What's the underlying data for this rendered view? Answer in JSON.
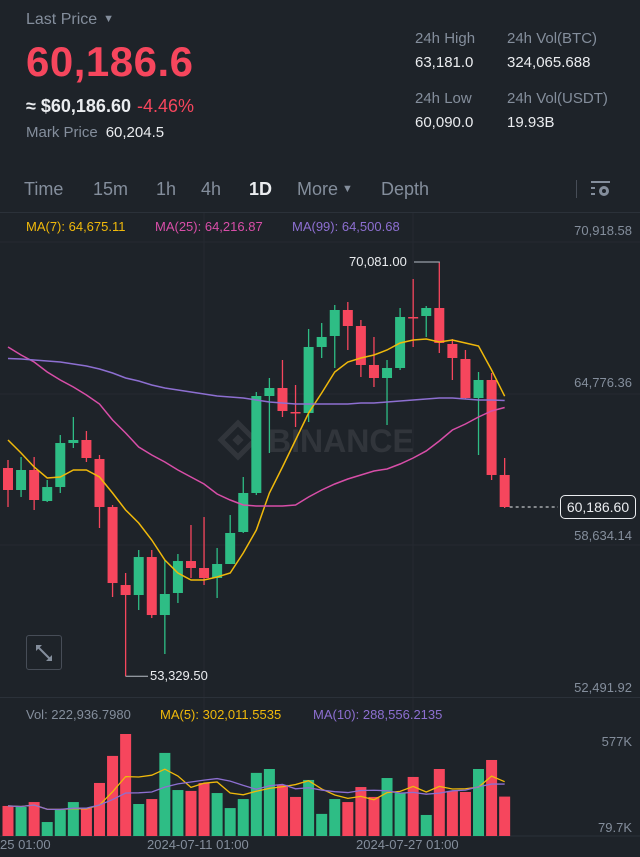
{
  "header": {
    "last_price_label": "Last Price",
    "last_price": "60,186.6",
    "usd_price": "≈ $60,186.60",
    "change_pct": "-4.46%",
    "mark_price_label": "Mark Price",
    "mark_price": "60,204.5",
    "stats": {
      "high_label": "24h High",
      "high": "63,181.0",
      "vol_btc_label": "24h Vol(BTC)",
      "vol_btc": "324,065.688",
      "low_label": "24h Low",
      "low": "60,090.0",
      "vol_usdt_label": "24h Vol(USDT)",
      "vol_usdt": "19.93B"
    }
  },
  "tabs": {
    "time": "Time",
    "m15": "15m",
    "h1": "1h",
    "h4": "4h",
    "d1": "1D",
    "more": "More",
    "depth": "Depth",
    "active": "1D",
    "settings_icon": "chart-settings-icon"
  },
  "colors": {
    "up": "#2ebd85",
    "down": "#f6465d",
    "ma7": "#f0b90b",
    "ma25": "#d84ea8",
    "ma99": "#8d6fd1",
    "background": "#1e2329"
  },
  "legend": {
    "ma7": "MA(7): 64,675.11",
    "ma25": "MA(25): 64,216.87",
    "ma99": "MA(99): 64,500.68"
  },
  "price_axis": [
    "70,918.58",
    "64,776.36",
    "58,634.14",
    "52,491.92"
  ],
  "current_price_tag": "60,186.60",
  "high_marker": "70,081.00",
  "low_marker": "53,329.50",
  "watermark": "BINANCE",
  "volume_legend": {
    "vol": "Vol: 222,936.7980",
    "ma5": "MA(5): 302,011.5535",
    "ma10": "MA(10): 288,556.2135"
  },
  "volume_axis": [
    "577K",
    "79.7K"
  ],
  "x_axis": [
    "25 01:00",
    "2024-07-11 01:00",
    "2024-07-27 01:00"
  ],
  "chart_data": {
    "type": "candlestick",
    "interval": "1D",
    "ohlc_format": [
      "open",
      "high",
      "low",
      "close"
    ],
    "candles": [
      [
        61766,
        62090,
        60186,
        60875
      ],
      [
        60875,
        62211,
        60591,
        61685
      ],
      [
        61685,
        62211,
        60065,
        60470
      ],
      [
        60429,
        61280,
        60389,
        60996
      ],
      [
        60996,
        63102,
        60754,
        62778
      ],
      [
        62778,
        63831,
        62576,
        62900
      ],
      [
        62900,
        63265,
        62009,
        62171
      ],
      [
        62130,
        62293,
        59336,
        60187
      ],
      [
        60187,
        60268,
        56541,
        57108
      ],
      [
        57027,
        57514,
        53329.5,
        56622
      ],
      [
        56622,
        58445,
        56015,
        58161
      ],
      [
        58161,
        58445,
        55690,
        55812
      ],
      [
        55812,
        58040,
        54233,
        56663
      ],
      [
        56704,
        58283,
        56298,
        57999
      ],
      [
        57999,
        59457,
        57311,
        57716
      ],
      [
        57716,
        59781,
        57027,
        57311
      ],
      [
        57311,
        58526,
        56501,
        57878
      ],
      [
        57878,
        59862,
        57878,
        59134
      ],
      [
        59174,
        61402,
        59134,
        60754
      ],
      [
        60754,
        64844,
        60673,
        64682
      ],
      [
        64682,
        65411,
        62374,
        65006
      ],
      [
        65006,
        66140,
        63831,
        64075
      ],
      [
        64034,
        65128,
        63427,
        63994
      ],
      [
        63994,
        67396,
        63629,
        66667
      ],
      [
        66667,
        67638,
        66221,
        67072
      ],
      [
        67112,
        68368,
        65816,
        68165
      ],
      [
        68165,
        68489,
        66545,
        67517
      ],
      [
        67517,
        67760,
        65452,
        65938
      ],
      [
        65938,
        67072,
        65047,
        65411
      ],
      [
        65411,
        66140,
        63508,
        65816
      ],
      [
        65816,
        68246,
        65735,
        67882
      ],
      [
        67882,
        69421,
        66667,
        67841
      ],
      [
        67922,
        68327,
        67072,
        68246
      ],
      [
        68246,
        70081,
        66424,
        66829
      ],
      [
        66788,
        66990,
        65330,
        66221
      ],
      [
        66181,
        66545,
        64560,
        64601
      ],
      [
        64601,
        65654,
        62292,
        65330
      ],
      [
        65330,
        65614,
        61280,
        61483
      ],
      [
        61483,
        62171,
        60146,
        60186.6
      ]
    ],
    "ma7": [
      62900,
      62374,
      61807,
      61361,
      61402,
      61685,
      61685,
      61402,
      60754,
      60065,
      59538,
      58850,
      58040,
      57514,
      57230,
      57230,
      57352,
      57514,
      58324,
      59255,
      60754,
      61807,
      62900,
      63994,
      64804,
      65654,
      66059,
      66221,
      66343,
      66545,
      66828,
      66950,
      66990,
      66869,
      66950,
      66828,
      66707,
      65735,
      64675
    ],
    "ma25": [
      66667,
      66343,
      66059,
      65654,
      65330,
      65046,
      64722,
      64358,
      63710,
      63184,
      62616,
      62292,
      62009,
      61685,
      61402,
      61118,
      60713,
      60470,
      60268,
      60227,
      60227,
      60227,
      60268,
      60592,
      60875,
      61118,
      61320,
      61483,
      61645,
      61726,
      61928,
      62171,
      62456,
      62860,
      63305,
      63548,
      63832,
      64075,
      64217
    ],
    "ma99": [
      66201,
      66181,
      66140,
      66100,
      66059,
      65978,
      65897,
      65776,
      65614,
      65411,
      65290,
      65128,
      65006,
      64925,
      64844,
      64763,
      64682,
      64642,
      64601,
      64520,
      64439,
      64399,
      64358,
      64358,
      64358,
      64358,
      64358,
      64399,
      64399,
      64439,
      64480,
      64520,
      64560,
      64601,
      64601,
      64560,
      64520,
      64520,
      64500
    ],
    "volume": [
      170000,
      164000,
      192000,
      79000,
      147000,
      192000,
      158000,
      300000,
      453000,
      577000,
      181000,
      209000,
      470000,
      260000,
      255000,
      300000,
      243000,
      158000,
      209000,
      357000,
      379000,
      289000,
      221000,
      317000,
      125000,
      209000,
      192000,
      277000,
      221000,
      328000,
      243000,
      334000,
      119000,
      379000,
      255000,
      249000,
      379000,
      430000,
      222937
    ],
    "price_range": [
      52491.92,
      70918.58
    ],
    "volume_range": [
      79700,
      577000
    ],
    "grid": true
  }
}
